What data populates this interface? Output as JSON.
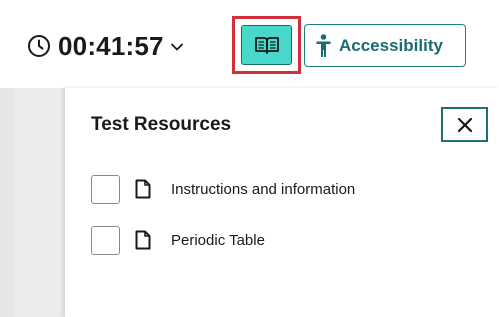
{
  "timer": {
    "time": "00:41:57"
  },
  "toolbar": {
    "accessibility_label": "Accessibility"
  },
  "panel": {
    "title": "Test Resources",
    "items": [
      {
        "label": "Instructions and information"
      },
      {
        "label": "Periodic Table"
      }
    ]
  },
  "colors": {
    "accent_teal": "#47d8cb",
    "accent_border": "#1f7f80",
    "highlight_red": "#d4303c"
  },
  "icons": [
    "clock-icon",
    "chevron-down-icon",
    "book-icon",
    "accessibility-person-icon",
    "close-icon",
    "document-icon"
  ]
}
